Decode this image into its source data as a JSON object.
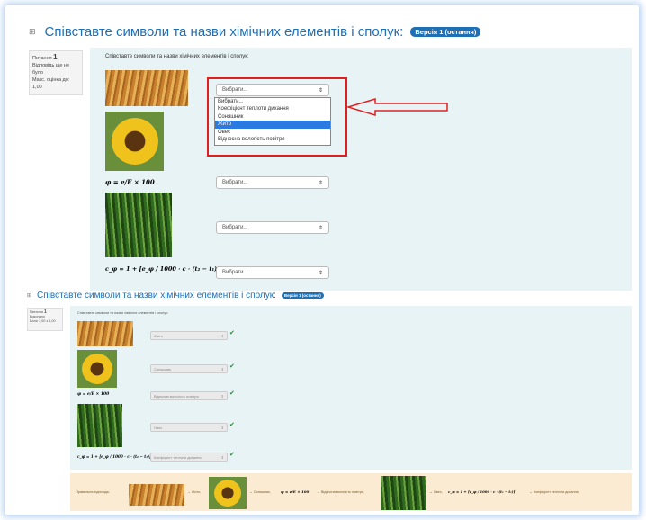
{
  "question_title": "Співставте символи та назви хімічних елементів і сполук:",
  "version_badge": "Версія 1 (остання)",
  "info": {
    "label": "Питання",
    "number": "1",
    "status": "Відповідь ще не було",
    "max_grade": "Макс. оцінка до: 1,00"
  },
  "question_text": "Співставте символи та назви хімічних елементів і сполук:",
  "formula1": "φ = e/E × 100",
  "formula2": "c_φ = 1 + [e_φ / 1000 · c · (t₂ − t₁)]",
  "select_placeholder": "Вибрати...",
  "dropdown_options": [
    "Вибрати...",
    "Коефіцієнт теплоти дихання",
    "Соняшник",
    "Жито",
    "Овес",
    "Відносна вологість повітря"
  ],
  "dropdown_selected_index": 3,
  "review": {
    "title": "Співставте символи та назви хімічних елементів і сполук:",
    "badge": "Версія 1 (остання)",
    "info_label": "Питання",
    "info_number": "1",
    "info_status": "Виконано",
    "info_grade": "Бали 1,00 з 1,00",
    "question_text": "Співставте символи та назви хімічних елементів і сполук:",
    "answers": [
      "Жито",
      "Соняшник",
      "Відносна вологість повітря",
      "Овес",
      "Коефіцієнт теплоти дихання"
    ]
  },
  "feedback": {
    "prefix": "Правильна відповідь:",
    "part1": "→ Жито,",
    "part2": "→ Соняшник,",
    "part3": "→ Відносна вологість повітря,",
    "part4": "→ Овес,",
    "part5": "→ Коефіцієнт теплоти дихання"
  },
  "colors": {
    "accent": "#1f6fb5",
    "panel": "#e7f3f5",
    "highlight": "#2a7ae2",
    "annotation_red": "#e02020",
    "feedback_bg": "#fbebd2",
    "correct_green": "#2a8a3a"
  }
}
